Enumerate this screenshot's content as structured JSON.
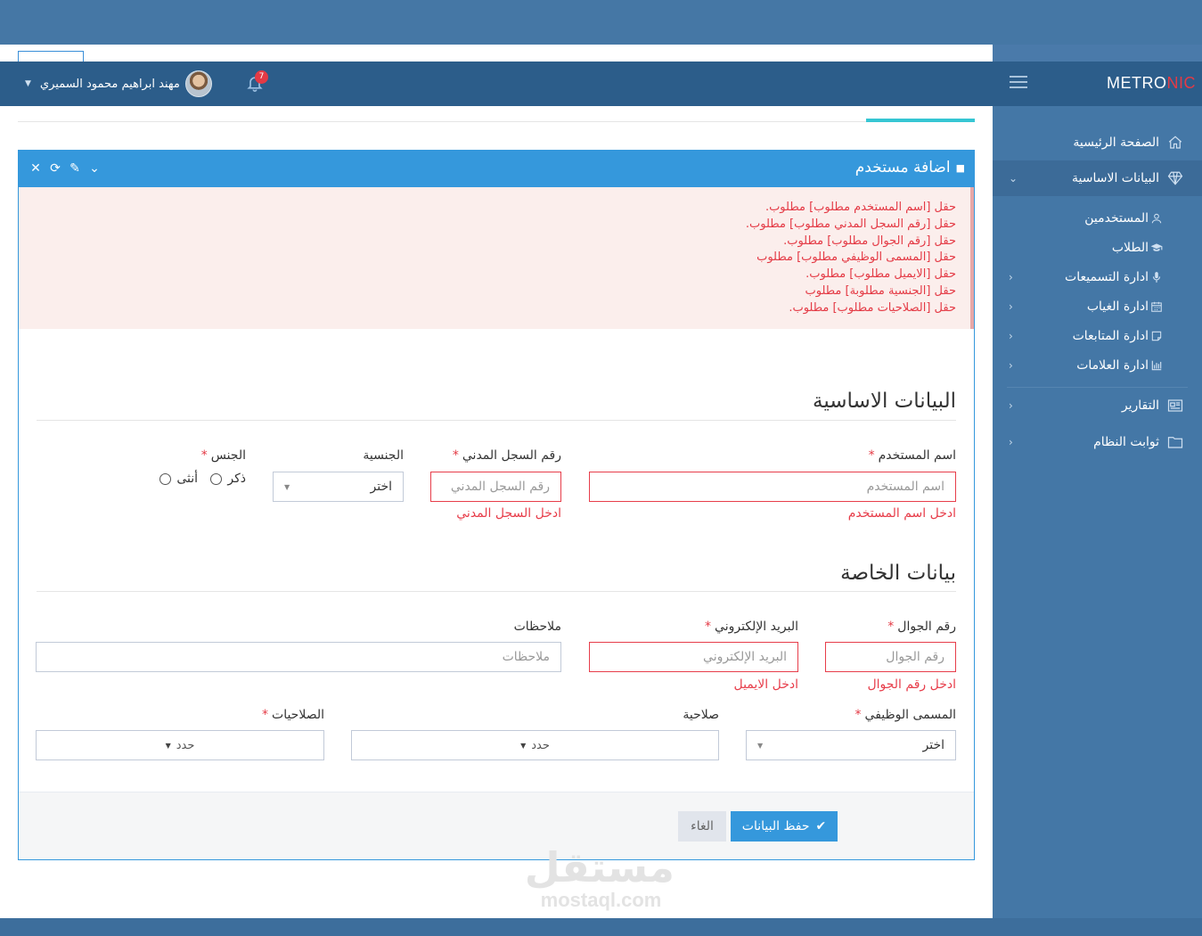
{
  "brand": {
    "logo_main": "METRO",
    "logo_accent": "NIC",
    "accent_color": "#e43a45",
    "header_color": "#2c5d8a",
    "sidebar_color": "#4477a6",
    "primary_color": "#3598dc"
  },
  "header": {
    "user_name": "مهند ابراهيم محمود السميري",
    "notification_count": "7"
  },
  "sidebar": {
    "home": "الصفحة الرئيسية",
    "basic_data": "البيانات الاساسية",
    "sub": {
      "users": "المستخدمين",
      "students": "الطلاب",
      "recordings": "ادارة التسميعات",
      "absence": "ادارة الغياب",
      "followups": "ادارة المتابعات",
      "grades": "ادارة العلامات"
    },
    "reports": "التقارير",
    "constants": "ثوابت النظام"
  },
  "portlet": {
    "title": "اضافة مستخدم"
  },
  "errors": [
    "حقل [اسم المستخدم مطلوب] مطلوب.",
    "حقل [رقم السجل المدني مطلوب] مطلوب.",
    "حقل [رقم الجوال مطلوب] مطلوب.",
    "حقل [المسمى الوظيفي مطلوب] مطلوب",
    "حقل [الايميل مطلوب] مطلوب.",
    "حقل [الجنسية مطلوبة] مطلوب",
    "حقل [الصلاحيات مطلوب] مطلوب."
  ],
  "basic_section": {
    "title": "البيانات الاساسية",
    "username": {
      "label": "اسم المستخدم",
      "placeholder": "اسم المستخدم",
      "error": "ادخل اسم المستخدم"
    },
    "civil_id": {
      "label": "رقم السجل المدني",
      "placeholder": "رقم السجل المدني",
      "error": "ادخل السجل المدني"
    },
    "nationality": {
      "label": "الجنسية",
      "value": "اختر"
    },
    "gender": {
      "label": "الجنس",
      "male": "ذكر",
      "female": "أنثى"
    }
  },
  "private_section": {
    "title": "بيانات الخاصة",
    "mobile": {
      "label": "رقم الجوال",
      "placeholder": "رقم الجوال",
      "error": "ادخل رقم الجوال"
    },
    "email": {
      "label": "البريد الإلكتروني",
      "placeholder": "البريد الإلكتروني",
      "error": "ادخل الايميل"
    },
    "notes": {
      "label": "ملاحظات",
      "placeholder": "ملاحظات"
    },
    "job_title": {
      "label": "المسمى الوظيفي",
      "value": "اختر"
    },
    "permission": {
      "label": "صلاحية",
      "value": "حدد"
    },
    "permissions": {
      "label": "الصلاحيات",
      "value": "حدد"
    }
  },
  "required_mark": "*",
  "actions": {
    "save": "حفظ البيانات",
    "cancel": "الغاء"
  },
  "watermark": {
    "arabic": "مستقل",
    "latin": "mostaql.com"
  }
}
